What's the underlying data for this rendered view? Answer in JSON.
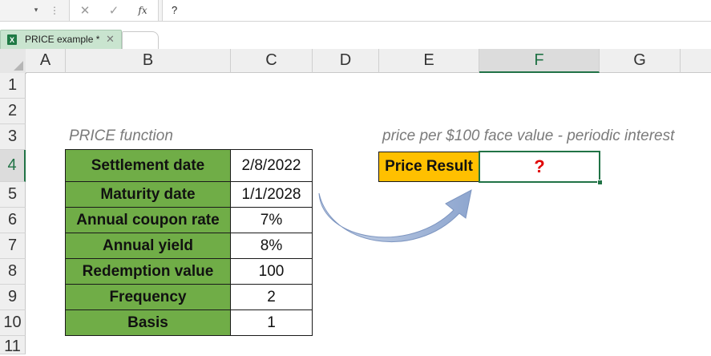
{
  "formula_bar": {
    "name_box_arrow": "▾",
    "dots": "⋮",
    "cancel_icon": "✕",
    "enter_icon": "✓",
    "fx_label": "fx",
    "content": "?"
  },
  "tabs": {
    "active": {
      "label": "PRICE example *",
      "close": "✕",
      "icon": "X"
    }
  },
  "columns": [
    "A",
    "B",
    "C",
    "D",
    "E",
    "F",
    "G"
  ],
  "selected_column": "F",
  "rows": [
    "1",
    "2",
    "3",
    "4",
    "5",
    "6",
    "7",
    "8",
    "9",
    "10",
    "11"
  ],
  "selected_row": "4",
  "sheet": {
    "title": "PRICE function",
    "note": "price per $100 face value - periodic interest",
    "params": [
      {
        "label": "Settlement date",
        "value": "2/8/2022"
      },
      {
        "label": "Maturity date",
        "value": "1/1/2028"
      },
      {
        "label": "Annual coupon rate",
        "value": "7%"
      },
      {
        "label": "Annual yield",
        "value": "8%"
      },
      {
        "label": "Redemption value",
        "value": "100"
      },
      {
        "label": "Frequency",
        "value": "2"
      },
      {
        "label": "Basis",
        "value": "1"
      }
    ],
    "result_label": "Price Result",
    "result_value": "?"
  },
  "colors": {
    "label_fill": "#70ad47",
    "result_label_fill": "#ffc000",
    "selection": "#217346",
    "question_mark": "#e00000",
    "arrow": "#9fb4d6"
  }
}
